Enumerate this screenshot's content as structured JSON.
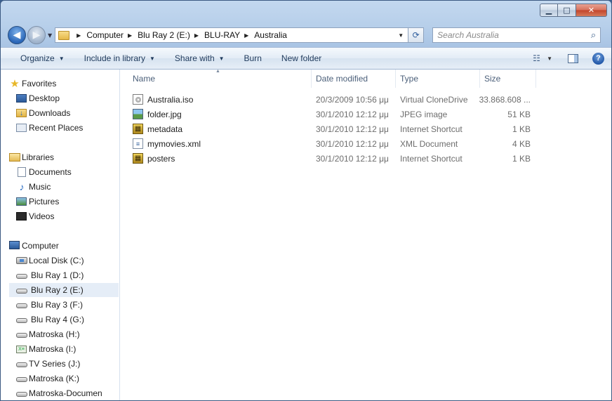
{
  "window": {
    "minimize_glyph": "▁",
    "maximize_glyph": "□",
    "close_glyph": "✕"
  },
  "address": {
    "back_glyph": "◀",
    "forward_glyph": "▶",
    "crumbs": [
      "Computer",
      "Blu Ray 2 (E:)",
      "BLU-RAY",
      "Australia"
    ],
    "refresh_glyph": "⟳"
  },
  "search": {
    "placeholder": "Search Australia"
  },
  "toolbar": {
    "organize": "Organize",
    "include_in_library": "Include in library",
    "share_with": "Share with",
    "burn": "Burn",
    "new_folder": "New folder",
    "help": "?"
  },
  "columns": {
    "name": "Name",
    "date_modified": "Date modified",
    "type": "Type",
    "size": "Size"
  },
  "files": [
    {
      "name": "Australia.iso",
      "date": "20/3/2009 10:56 μμ",
      "type": "Virtual CloneDrive",
      "size": "33.868.608 ...",
      "icon": "iso-icon"
    },
    {
      "name": "folder.jpg",
      "date": "30/1/2010 12:12 μμ",
      "type": "JPEG image",
      "size": "51 KB",
      "icon": "jpeg-icon"
    },
    {
      "name": "metadata",
      "date": "30/1/2010 12:12 μμ",
      "type": "Internet Shortcut",
      "size": "1 KB",
      "icon": "shortcut-icon"
    },
    {
      "name": "mymovies.xml",
      "date": "30/1/2010 12:12 μμ",
      "type": "XML Document",
      "size": "4 KB",
      "icon": "xml-icon"
    },
    {
      "name": "posters",
      "date": "30/1/2010 12:12 μμ",
      "type": "Internet Shortcut",
      "size": "1 KB",
      "icon": "shortcut-icon"
    }
  ],
  "nav": {
    "favorites": "Favorites",
    "desktop": "Desktop",
    "downloads": "Downloads",
    "recent_places": "Recent Places",
    "libraries": "Libraries",
    "documents": "Documents",
    "music": "Music",
    "pictures": "Pictures",
    "videos": "Videos",
    "computer": "Computer",
    "drives": [
      "Local Disk (C:)",
      "Blu Ray 1 (D:)",
      "Blu Ray 2 (E:)",
      "Blu Ray 3 (F:)",
      "Blu Ray 4 (G:)",
      "Matroska (H:)",
      "Matroska (I:)",
      "TV Series (J:)",
      "Matroska (K:)",
      "Matroska-Documen"
    ],
    "selected_drive": "Blu Ray 2 (E:)"
  },
  "colors": {
    "accent": "#2a66b8",
    "selection": "#e5edf7"
  }
}
